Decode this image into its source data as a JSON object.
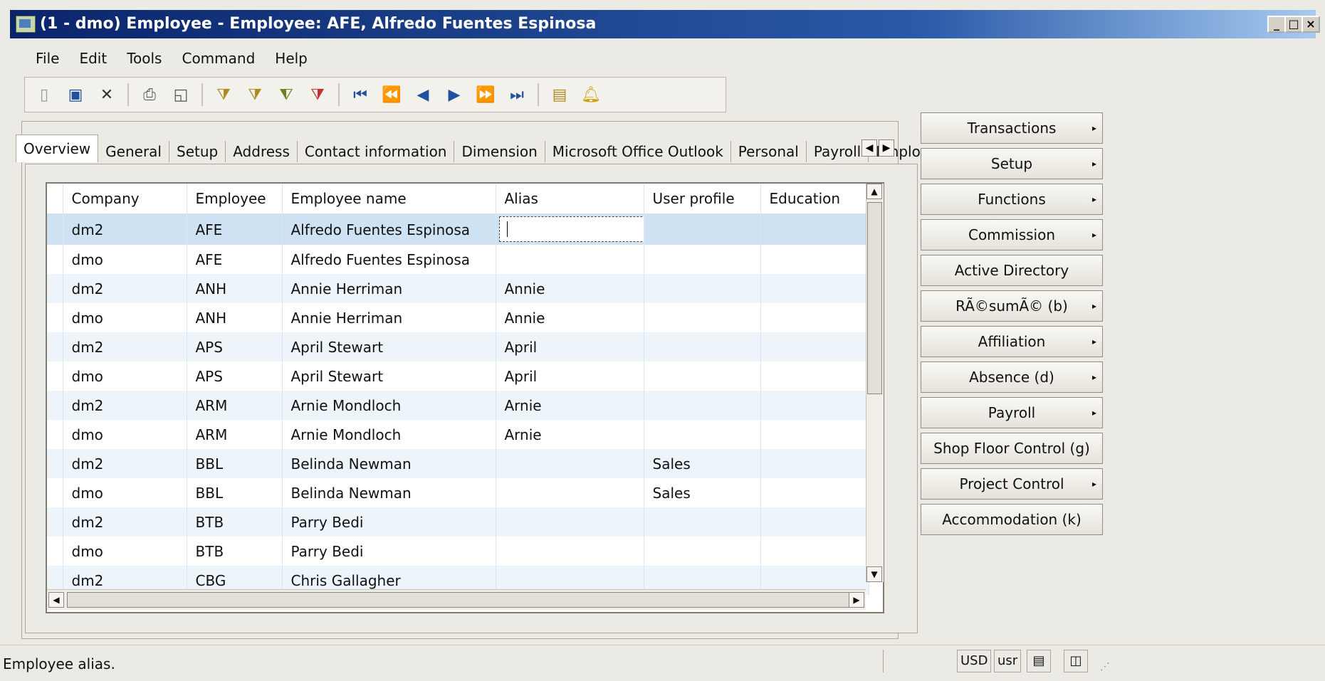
{
  "window": {
    "title": "(1 - dmo) Employee - Employee: AFE, Alfredo Fuentes Espinosa",
    "minimize": "_",
    "maximize": "□",
    "close": "×"
  },
  "menu": [
    "File",
    "Edit",
    "Tools",
    "Command",
    "Help"
  ],
  "toolbar": {
    "icons": [
      "new-icon",
      "save-icon",
      "delete-icon",
      "print-icon",
      "print-preview-icon",
      "filter-icon",
      "filter-by-selection-icon",
      "advanced-filter-icon",
      "remove-filter-icon",
      "first-record-icon",
      "previous-page-icon",
      "previous-record-icon",
      "next-record-icon",
      "next-page-icon",
      "last-record-icon",
      "attachments-icon",
      "alerts-icon"
    ]
  },
  "tabs": [
    "Overview",
    "General",
    "Setup",
    "Address",
    "Contact information",
    "Dimension",
    "Microsoft Office Outlook",
    "Personal",
    "Payroll",
    "Employ"
  ],
  "grid": {
    "columns": [
      "Company",
      "Employee",
      "Employee name",
      "Alias",
      "User profile",
      "Education"
    ],
    "rows": [
      [
        "dm2",
        "AFE",
        "Alfredo Fuentes Espinosa",
        "",
        "",
        ""
      ],
      [
        "dmo",
        "AFE",
        "Alfredo Fuentes Espinosa",
        "",
        "",
        ""
      ],
      [
        "dm2",
        "ANH",
        "Annie Herriman",
        "Annie",
        "",
        ""
      ],
      [
        "dmo",
        "ANH",
        "Annie Herriman",
        "Annie",
        "",
        ""
      ],
      [
        "dm2",
        "APS",
        "April Stewart",
        "April",
        "",
        ""
      ],
      [
        "dmo",
        "APS",
        "April Stewart",
        "April",
        "",
        ""
      ],
      [
        "dm2",
        "ARM",
        "Arnie Mondloch",
        "Arnie",
        "",
        ""
      ],
      [
        "dmo",
        "ARM",
        "Arnie Mondloch",
        "Arnie",
        "",
        ""
      ],
      [
        "dm2",
        "BBL",
        "Belinda Newman",
        "",
        "Sales",
        ""
      ],
      [
        "dmo",
        "BBL",
        "Belinda Newman",
        "",
        "Sales",
        ""
      ],
      [
        "dm2",
        "BTB",
        "Parry Bedi",
        "",
        "",
        ""
      ],
      [
        "dmo",
        "BTB",
        "Parry Bedi",
        "",
        "",
        ""
      ],
      [
        "dm2",
        "CBG",
        "Chris Gallagher",
        "",
        "",
        ""
      ]
    ]
  },
  "side_buttons": [
    {
      "label": "Transactions",
      "arrow": "▸"
    },
    {
      "label": "Setup",
      "arrow": "▸"
    },
    {
      "label": "Functions",
      "arrow": "▸"
    },
    {
      "label": "Commission",
      "arrow": "▸"
    },
    {
      "label": "Active Directory",
      "arrow": ""
    },
    {
      "label": "RÃ©sumÃ© (b)",
      "arrow": "▸"
    },
    {
      "label": "Affiliation",
      "arrow": "▸"
    },
    {
      "label": "Absence (d)",
      "arrow": "▸"
    },
    {
      "label": "Payroll",
      "arrow": "▸"
    },
    {
      "label": "Shop Floor Control (g)",
      "arrow": ""
    },
    {
      "label": "Project Control",
      "arrow": "▸"
    },
    {
      "label": "Accommodation (k)",
      "arrow": ""
    }
  ],
  "status": {
    "text": "Employee alias.",
    "currency": "USD",
    "user": "usr"
  }
}
